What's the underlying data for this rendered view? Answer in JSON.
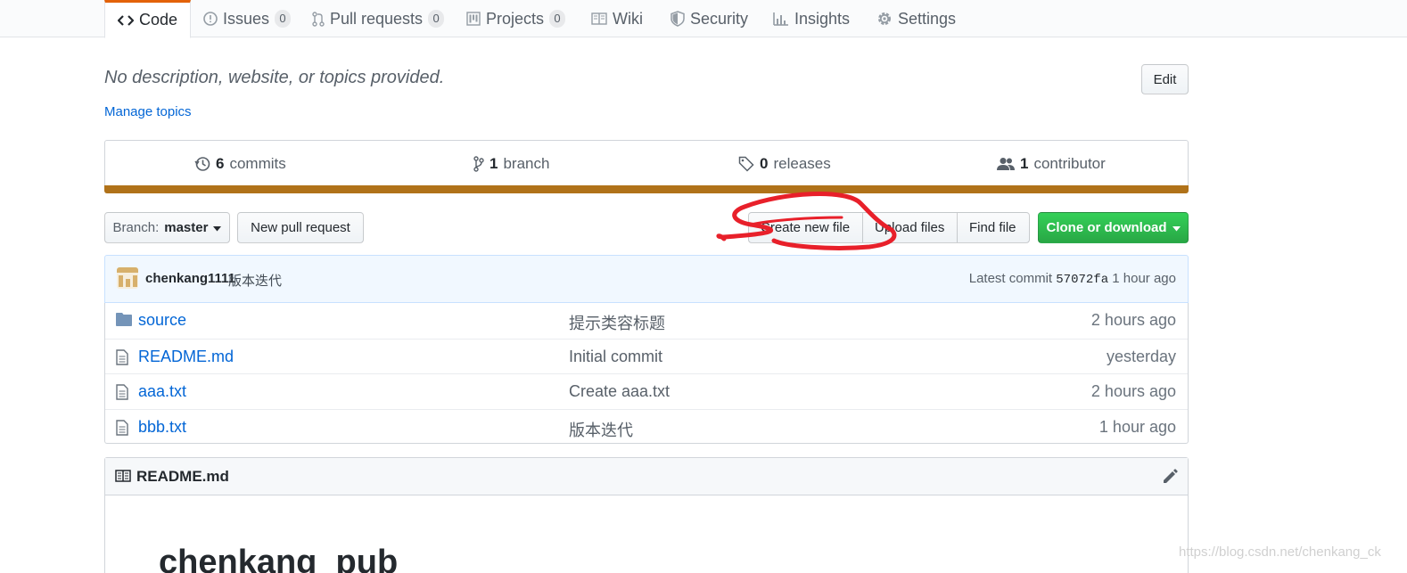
{
  "tabs": [
    {
      "label": "Code",
      "icon": "code-icon"
    },
    {
      "label": "Issues",
      "count": "0",
      "icon": "issue-icon"
    },
    {
      "label": "Pull requests",
      "count": "0",
      "icon": "pull-request-icon"
    },
    {
      "label": "Projects",
      "count": "0",
      "icon": "project-icon"
    },
    {
      "label": "Wiki",
      "icon": "book-icon"
    },
    {
      "label": "Security",
      "icon": "shield-icon"
    },
    {
      "label": "Insights",
      "icon": "graph-icon"
    },
    {
      "label": "Settings",
      "icon": "gear-icon"
    }
  ],
  "repo": {
    "description": "No description, website, or topics provided.",
    "manage_topics": "Manage topics",
    "edit_label": "Edit"
  },
  "summary": {
    "commits": {
      "count": "6",
      "label": "commits"
    },
    "branches": {
      "count": "1",
      "label": "branch"
    },
    "releases": {
      "count": "0",
      "label": "releases"
    },
    "contributors": {
      "count": "1",
      "label": "contributor"
    },
    "language_color": "#b07219"
  },
  "filenav": {
    "branch_prefix": "Branch:",
    "branch_name": "master",
    "new_pull_request": "New pull request",
    "create_new_file": "Create new file",
    "upload_files": "Upload files",
    "find_file": "Find file",
    "clone_or_download": "Clone or download"
  },
  "latest_commit": {
    "author": "chenkang1111",
    "message": "版本迭代",
    "prefix": "Latest commit",
    "sha": "57072fa",
    "age": "1 hour ago"
  },
  "files": [
    {
      "type": "directory",
      "name": "source",
      "message": "提示类容标题",
      "age": "2 hours ago"
    },
    {
      "type": "file",
      "name": "README.md",
      "message": "Initial commit",
      "age": "yesterday"
    },
    {
      "type": "file",
      "name": "aaa.txt",
      "message": "Create aaa.txt",
      "age": "2 hours ago"
    },
    {
      "type": "file",
      "name": "bbb.txt",
      "message": "版本迭代",
      "age": "1 hour ago"
    }
  ],
  "readme": {
    "title": "README.md",
    "heading": "chenkang_pub"
  },
  "watermark": "https://blog.csdn.net/chenkang_ck",
  "colors": {
    "accent": "#0366d6",
    "clone_green": "#28a745",
    "annotation_red": "#e8202a",
    "selected_tab_border": "#e36209"
  }
}
